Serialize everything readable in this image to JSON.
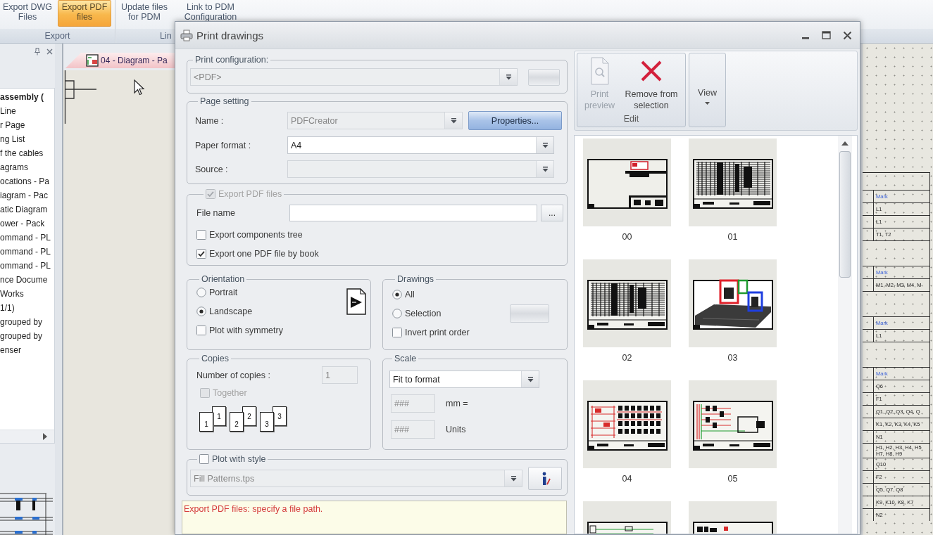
{
  "ribbon": {
    "groups": [
      {
        "label": "Export",
        "buttons": [
          {
            "label": "Export DWG Files",
            "selected": false
          },
          {
            "label": "Export PDF files",
            "selected": true
          }
        ]
      },
      {
        "label": "Lin",
        "buttons": [
          {
            "label": "Update files for PDM",
            "selected": false
          },
          {
            "label": "Link to PDM Configuration",
            "selected": false
          }
        ]
      }
    ]
  },
  "project_tree": {
    "items": [
      {
        "label": "assembly (",
        "kind": "root"
      },
      {
        "label": "Line",
        "kind": "item"
      },
      {
        "label": "r Page",
        "kind": "item"
      },
      {
        "label": "ng List",
        "kind": "item"
      },
      {
        "label": "f the cables",
        "kind": "item"
      },
      {
        "label": "agrams",
        "kind": "item"
      },
      {
        "label": "ocations - Pa",
        "kind": "item"
      },
      {
        "label": "iagram - Pac",
        "kind": "item"
      },
      {
        "label": "atic Diagram",
        "kind": "item"
      },
      {
        "label": "ower - Pack",
        "kind": "item"
      },
      {
        "label": "ommand - PL",
        "kind": "item"
      },
      {
        "label": "ommand - PL",
        "kind": "item"
      },
      {
        "label": "ommand - PL",
        "kind": "item"
      },
      {
        "label": "nce Docume",
        "kind": "item"
      },
      {
        "label": "Works",
        "kind": "item"
      },
      {
        "label": "1/1)",
        "kind": "item"
      },
      {
        "label": "grouped by",
        "kind": "item"
      },
      {
        "label": "grouped by",
        "kind": "item"
      },
      {
        "label": "enser",
        "kind": "item"
      }
    ]
  },
  "document_tab": {
    "title": "04 - Diagram - Pa"
  },
  "drawing_table": {
    "groups": [
      {
        "header": "Mark",
        "items": [
          "L1",
          "L1",
          "T1, T2"
        ]
      },
      {
        "header": "Mark",
        "items": [
          "M1, M2, M3, M4, M"
        ]
      },
      {
        "header": "Mark",
        "items": [
          "L1"
        ]
      },
      {
        "header": "Mark",
        "items": [
          "Q6",
          "F1",
          "Q1, Q2, Q3, Q4, Q",
          "K1, K2, K3, K4, K5",
          "N1",
          "H1, H2, H3, H4, H5 H7, H8, H9",
          "Q10",
          "F2",
          "Q5, Q7, Q8",
          "K9, K10, K8, K7",
          "N2"
        ]
      }
    ]
  },
  "dialog": {
    "title": "Print drawings",
    "print_configuration": {
      "label": "Print configuration:",
      "value": "<PDF>",
      "disabled": true
    },
    "page_setting": {
      "label": "Page setting",
      "fields": [
        {
          "label": "Name :",
          "value": "PDFCreator",
          "disabled": true
        },
        {
          "label": "Paper format :",
          "value": "A4",
          "disabled": false
        },
        {
          "label": "Source :",
          "disabled": true
        }
      ],
      "properties_button": "Properties..."
    },
    "export_pdf": {
      "label": "Export PDF files",
      "checked": true,
      "disabled": true,
      "file_name_label": "File name",
      "browse_button": "...",
      "options": [
        {
          "label": "Export components tree",
          "checked": false
        },
        {
          "label": "Export one PDF file by book",
          "checked": true
        }
      ]
    },
    "orientation": {
      "label": "Orientation",
      "options": [
        {
          "kind": "radio",
          "label": "Portrait",
          "selected": false
        },
        {
          "kind": "radio",
          "label": "Landscape",
          "selected": true
        },
        {
          "kind": "checkbox",
          "label": "Plot with symmetry",
          "checked": false
        }
      ]
    },
    "drawings": {
      "label": "Drawings",
      "options": [
        {
          "kind": "radio",
          "label": "All",
          "selected": true
        },
        {
          "kind": "radio",
          "label": "Selection",
          "selected": false
        },
        {
          "kind": "checkbox",
          "label": "Invert print order",
          "checked": false
        }
      ]
    },
    "copies": {
      "label": "Copies",
      "count_label": "Number of copies :",
      "count": "1",
      "count_disabled": true,
      "together": {
        "label": "Together",
        "checked": false,
        "disabled": true
      },
      "collate_pages": [
        {
          "front": "1",
          "back": "1"
        },
        {
          "front": "2",
          "back": "2"
        },
        {
          "front": "3",
          "back": "3"
        }
      ]
    },
    "scale": {
      "label": "Scale",
      "mode": "Fit to format",
      "fields": [
        {
          "value": "###",
          "unit": "mm =",
          "disabled": true
        },
        {
          "value": "###",
          "unit": "Units",
          "disabled": true
        }
      ]
    },
    "plot_with_style": {
      "label": "Plot with style",
      "checked": false,
      "style_file": "Fill Patterns.tps",
      "disabled": true
    },
    "message": "Export PDF files: specify a file path.",
    "toolbar": {
      "groups": [
        {
          "label": "Edit",
          "buttons": [
            {
              "kind": "preview",
              "label": "Print preview",
              "disabled": true
            },
            {
              "kind": "remove",
              "label": "Remove from selection",
              "disabled": false
            }
          ]
        },
        {
          "buttons": [
            {
              "kind": "menu",
              "label": "View",
              "disabled": false
            }
          ]
        }
      ]
    },
    "thumbnails": [
      {
        "label": "00",
        "kind": "cover"
      },
      {
        "label": "01",
        "kind": "table"
      },
      {
        "label": "02",
        "kind": "table"
      },
      {
        "label": "03",
        "kind": "model"
      },
      {
        "label": "04",
        "kind": "schematic"
      },
      {
        "label": "05",
        "kind": "wiring"
      },
      {
        "kind": "layout"
      },
      {
        "kind": "panel"
      }
    ]
  }
}
